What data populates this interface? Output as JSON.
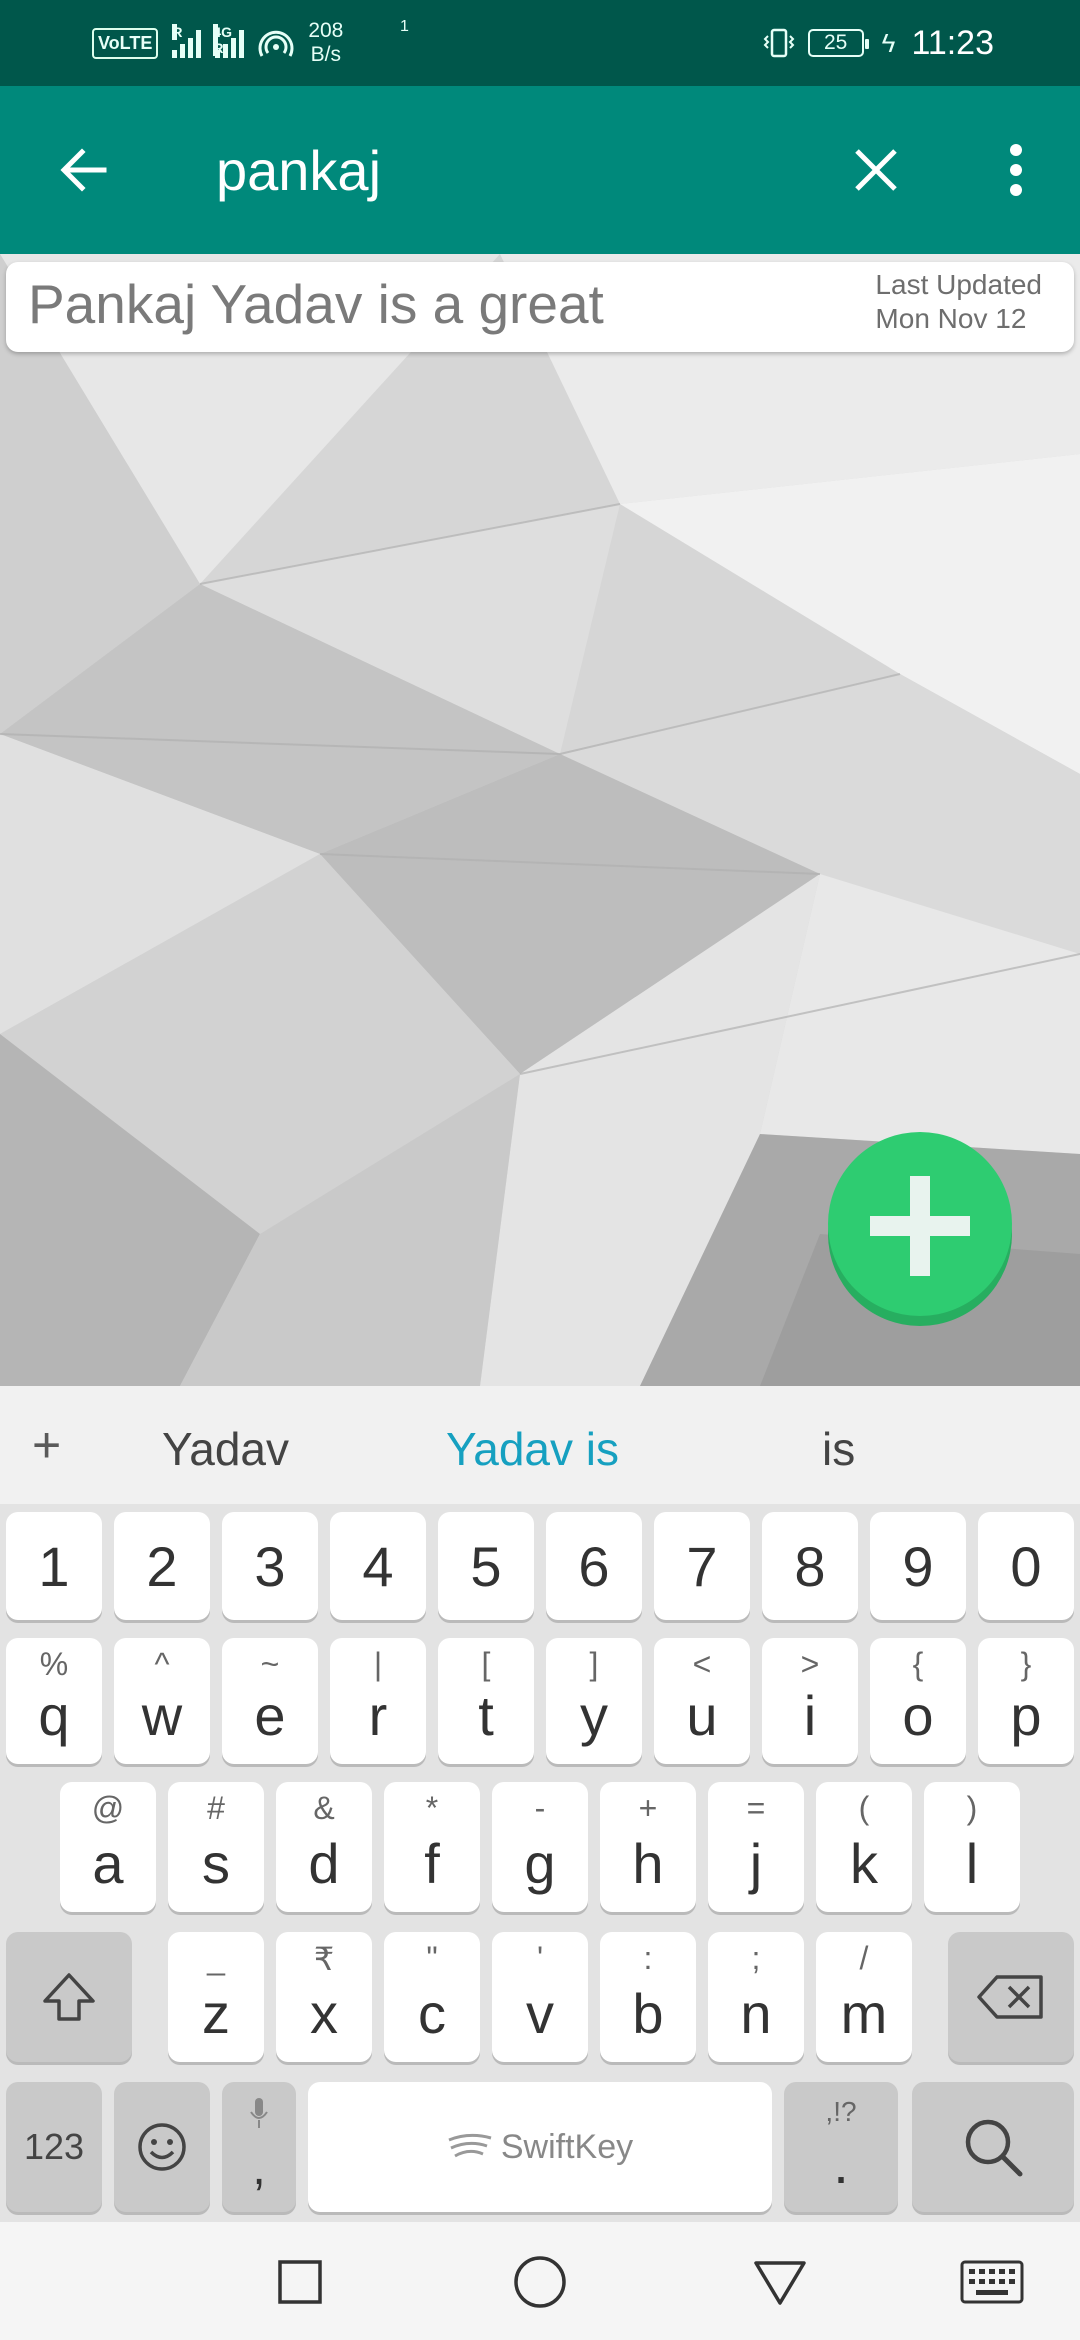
{
  "status_bar": {
    "volte": "VoLTE",
    "sig1_tag": "R",
    "sig2_tag": "4G R",
    "wifi_num": "1",
    "speed_value": "208",
    "speed_unit": "B/s",
    "battery": "25",
    "time": "11:23"
  },
  "app_bar": {
    "search_value": "pankaj",
    "icons": [
      "back-arrow-icon",
      "close-icon",
      "more-vert-icon"
    ]
  },
  "note": {
    "title": "Pankaj Yadav is a great",
    "meta_line1": "Last Updated",
    "meta_line2": "Mon Nov 12"
  },
  "fab": {
    "icon": "plus-icon",
    "color": "#2ecc71"
  },
  "keyboard": {
    "suggestion_plus": "+",
    "suggestions": [
      "Yadav",
      "Yadav is",
      "is"
    ],
    "number_row": [
      "1",
      "2",
      "3",
      "4",
      "5",
      "6",
      "7",
      "8",
      "9",
      "0"
    ],
    "row1": [
      {
        "alt": "%",
        "main": "q"
      },
      {
        "alt": "^",
        "main": "w"
      },
      {
        "alt": "~",
        "main": "e"
      },
      {
        "alt": "|",
        "main": "r"
      },
      {
        "alt": "[",
        "main": "t"
      },
      {
        "alt": "]",
        "main": "y"
      },
      {
        "alt": "<",
        "main": "u"
      },
      {
        "alt": ">",
        "main": "i"
      },
      {
        "alt": "{",
        "main": "o"
      },
      {
        "alt": "}",
        "main": "p"
      }
    ],
    "row2": [
      {
        "alt": "@",
        "main": "a"
      },
      {
        "alt": "#",
        "main": "s"
      },
      {
        "alt": "&",
        "main": "d"
      },
      {
        "alt": "*",
        "main": "f"
      },
      {
        "alt": "-",
        "main": "g"
      },
      {
        "alt": "+",
        "main": "h"
      },
      {
        "alt": "=",
        "main": "j"
      },
      {
        "alt": "(",
        "main": "k"
      },
      {
        "alt": ")",
        "main": "l"
      }
    ],
    "row3": [
      {
        "alt": "_",
        "main": "z"
      },
      {
        "alt": "₹",
        "main": "x"
      },
      {
        "alt": "\"",
        "main": "c"
      },
      {
        "alt": "'",
        "main": "v"
      },
      {
        "alt": ":",
        "main": "b"
      },
      {
        "alt": ";",
        "main": "n"
      },
      {
        "alt": "/",
        "main": "m"
      }
    ],
    "bottom": {
      "numbers_key": "123",
      "comma": ",",
      "space_brand": "SwiftKey",
      "punct_alt": ",!?",
      "period": "."
    }
  },
  "accent": {
    "status_bar": "#00574b",
    "app_bar": "#00897b",
    "suggestion_active": "#16a0c0"
  }
}
